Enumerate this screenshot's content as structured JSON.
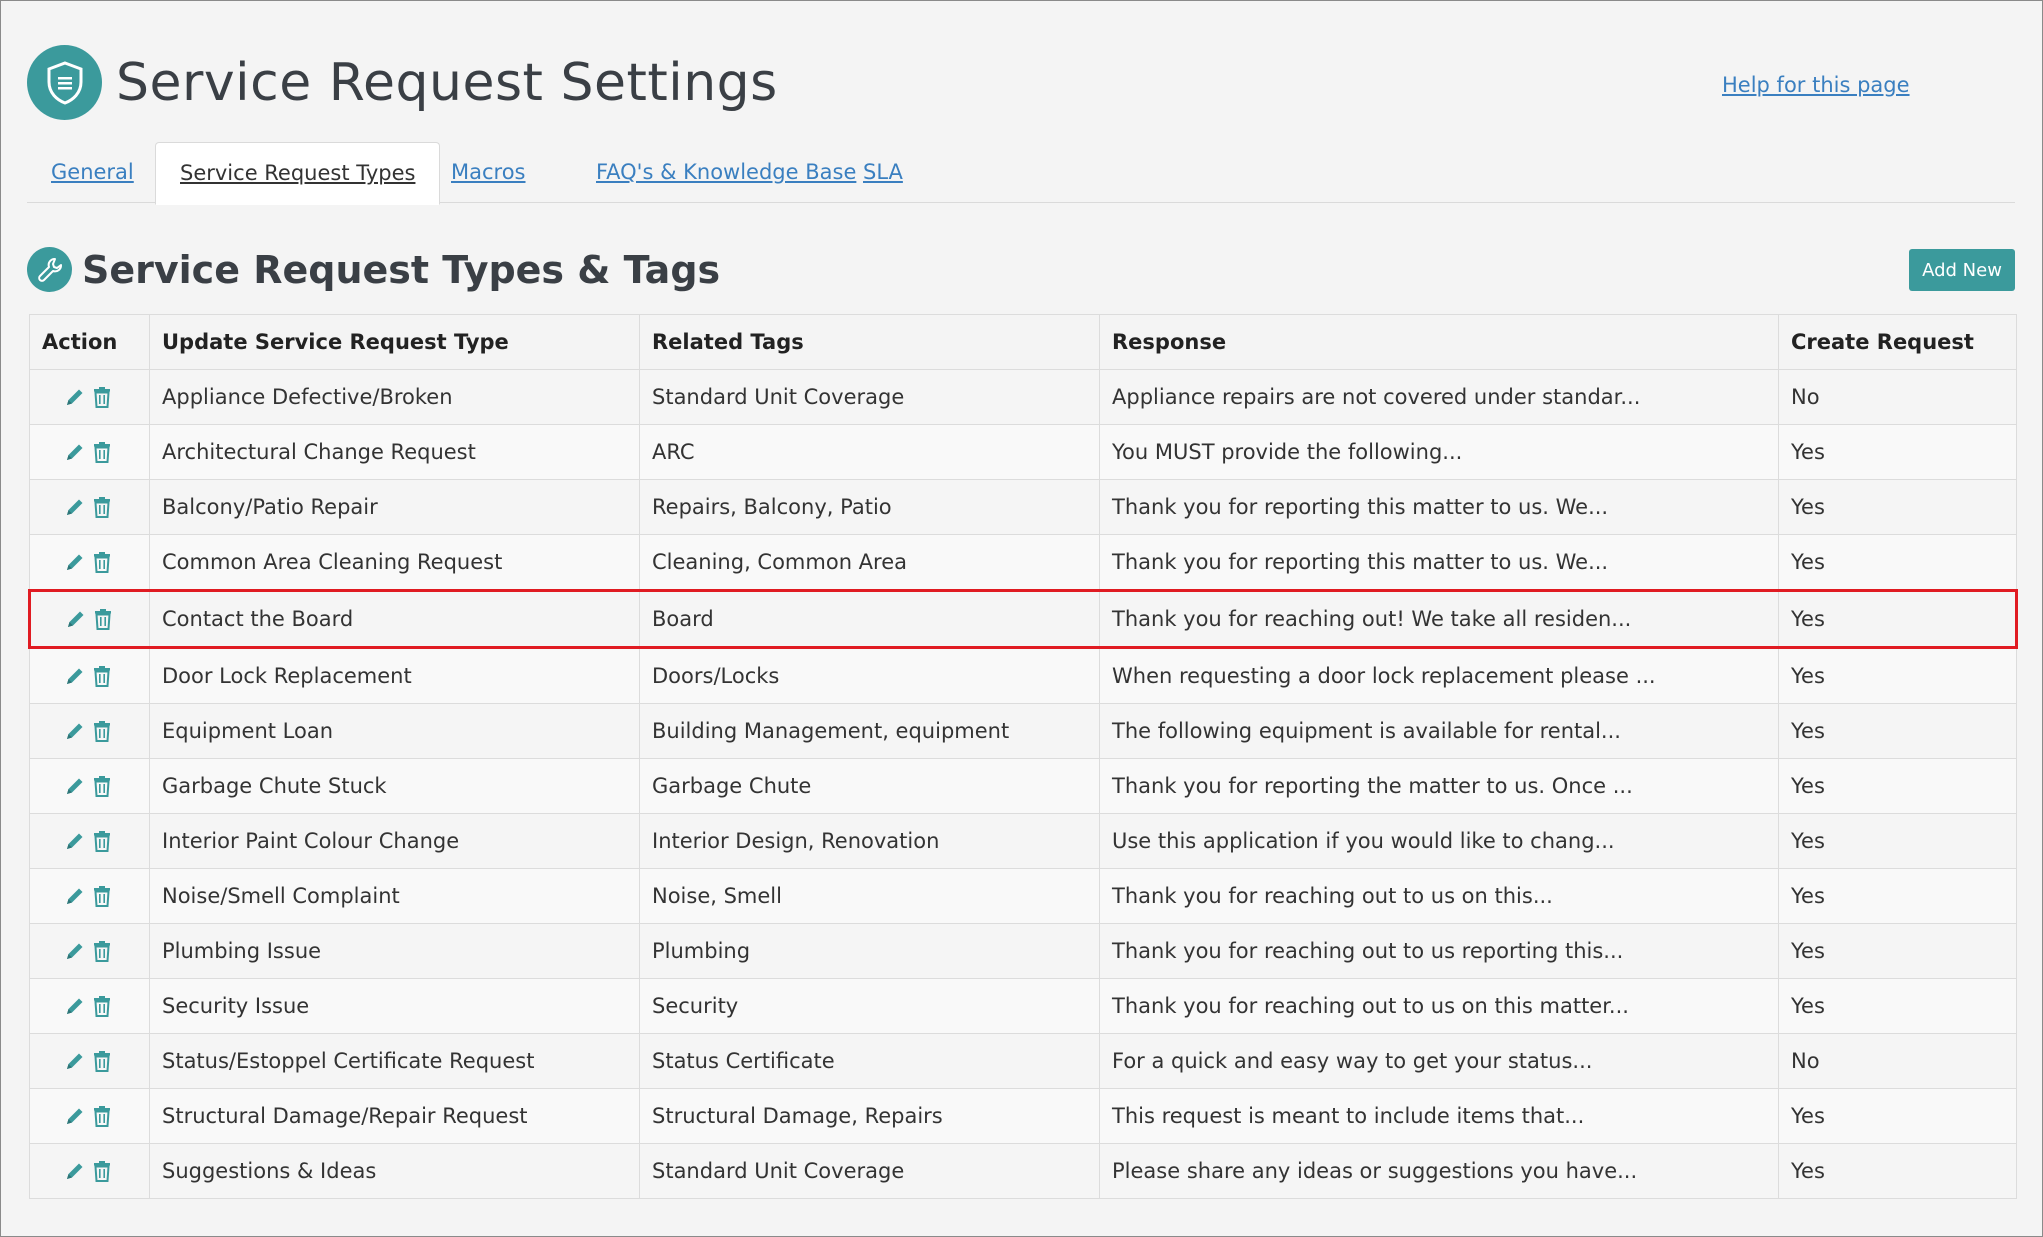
{
  "page": {
    "title": "Service Request Settings",
    "help_link": "Help for this page"
  },
  "tabs": [
    {
      "label": "General",
      "active": false
    },
    {
      "label": "Service Request Types",
      "active": true
    },
    {
      "label": "Macros",
      "active": false
    },
    {
      "label": "FAQ's & Knowledge Base",
      "active": false
    },
    {
      "label": "SLA",
      "active": false
    }
  ],
  "section": {
    "title": "Service Request Types & Tags",
    "add_button": "Add New"
  },
  "table": {
    "headers": [
      "Action",
      "Update Service Request Type",
      "Related Tags",
      "Response",
      "Create Request"
    ],
    "rows": [
      {
        "type": "Appliance Defective/Broken",
        "tags": "Standard Unit Coverage",
        "response": "Appliance repairs are not covered under standar...",
        "create": "No"
      },
      {
        "type": "Architectural Change Request",
        "tags": "ARC",
        "response": "You MUST provide the following...",
        "create": "Yes"
      },
      {
        "type": "Balcony/Patio Repair",
        "tags": "Repairs, Balcony, Patio",
        "response": "Thank you for reporting this matter to us. We...",
        "create": "Yes"
      },
      {
        "type": "Common Area Cleaning Request",
        "tags": "Cleaning, Common Area",
        "response": "Thank you for reporting this matter to us. We...",
        "create": "Yes"
      },
      {
        "type": "Contact the Board",
        "tags": "Board",
        "response": "Thank you for reaching out! We take all residen...",
        "create": "Yes",
        "highlighted": true
      },
      {
        "type": "Door Lock Replacement",
        "tags": "Doors/Locks",
        "response": "When requesting a door lock replacement please ...",
        "create": "Yes"
      },
      {
        "type": "Equipment Loan",
        "tags": "Building Management, equipment",
        "response": "The following equipment is available for rental...",
        "create": "Yes"
      },
      {
        "type": "Garbage Chute Stuck",
        "tags": "Garbage Chute",
        "response": "Thank you for reporting the matter to us. Once ...",
        "create": "Yes"
      },
      {
        "type": "Interior Paint Colour Change",
        "tags": "Interior Design, Renovation",
        "response": "Use this application if you would like to chang...",
        "create": "Yes"
      },
      {
        "type": "Noise/Smell Complaint",
        "tags": "Noise, Smell",
        "response": "Thank you for reaching out to us on this...",
        "create": "Yes"
      },
      {
        "type": "Plumbing Issue",
        "tags": "Plumbing",
        "response": "Thank you for reaching out to us reporting this...",
        "create": "Yes"
      },
      {
        "type": "Security Issue",
        "tags": "Security",
        "response": "Thank you for reaching out to us on this matter...",
        "create": "Yes"
      },
      {
        "type": "Status/Estoppel Certificate Request",
        "tags": "Status Certificate",
        "response": "For a quick and easy way to get your status...",
        "create": "No"
      },
      {
        "type": "Structural Damage/Repair Request",
        "tags": "Structural Damage, Repairs",
        "response": "This request is meant to include items that...",
        "create": "Yes"
      },
      {
        "type": "Suggestions & Ideas",
        "tags": "Standard Unit Coverage",
        "response": "Please share any ideas or suggestions you have...",
        "create": "Yes"
      }
    ]
  },
  "icons": {
    "logo": "shield-icon",
    "section": "wrench-icon",
    "edit": "pencil-icon",
    "delete": "trash-icon"
  },
  "colors": {
    "accent": "#3b9a9c",
    "link": "#3a7fc0",
    "highlight_border": "#e01b22"
  }
}
